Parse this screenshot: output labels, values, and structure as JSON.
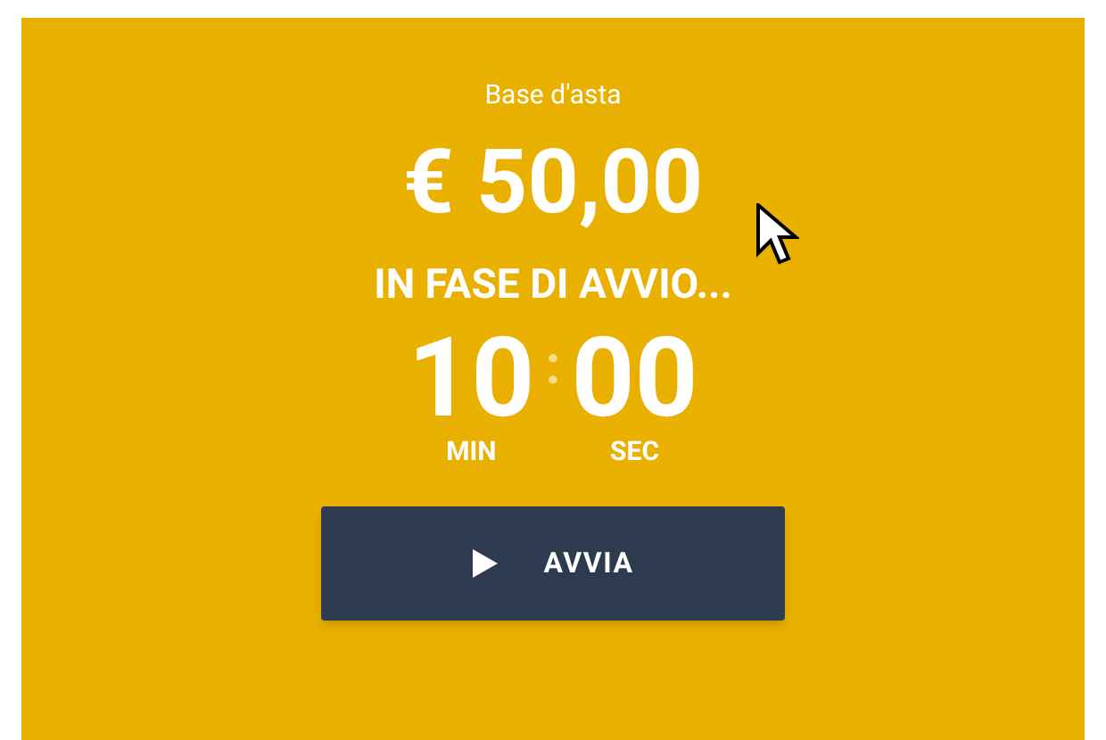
{
  "base_label": "Base d'asta",
  "price": "€ 50,00",
  "status": "IN FASE DI AVVIO...",
  "timer": {
    "minutes": "10",
    "separator": ":",
    "seconds": "00",
    "minutes_label": "MIN",
    "seconds_label": "SEC"
  },
  "button": {
    "label": "AVVIA"
  }
}
